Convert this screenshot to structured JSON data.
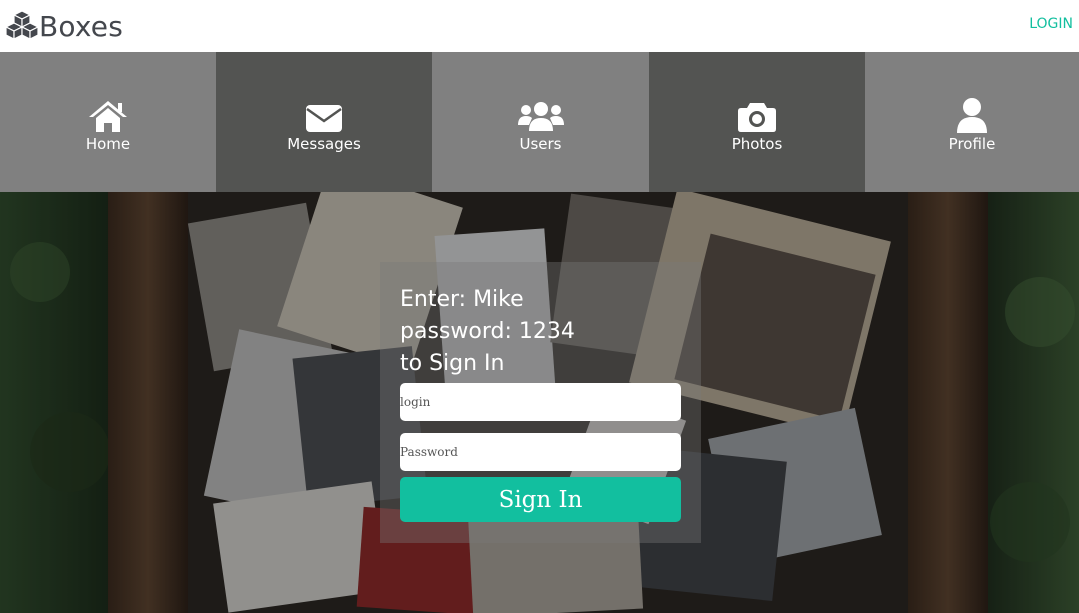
{
  "header": {
    "logo_text": "Boxes",
    "logo_icon": "cubes-icon",
    "login_link": "LOGIN"
  },
  "nav": {
    "items": [
      {
        "label": "Home",
        "icon": "home-icon"
      },
      {
        "label": "Messages",
        "icon": "envelope-icon"
      },
      {
        "label": "Users",
        "icon": "users-icon"
      },
      {
        "label": "Photos",
        "icon": "camera-icon"
      },
      {
        "label": "Profile",
        "icon": "user-icon"
      }
    ]
  },
  "login": {
    "instruction": "Enter: Mike\npassword: 1234\nto Sign In",
    "login_placeholder": "login",
    "password_placeholder": "Password",
    "submit_label": "Sign In"
  },
  "colors": {
    "accent": "#12bf9f",
    "nav_light": "#808080",
    "nav_dark": "#535452"
  }
}
